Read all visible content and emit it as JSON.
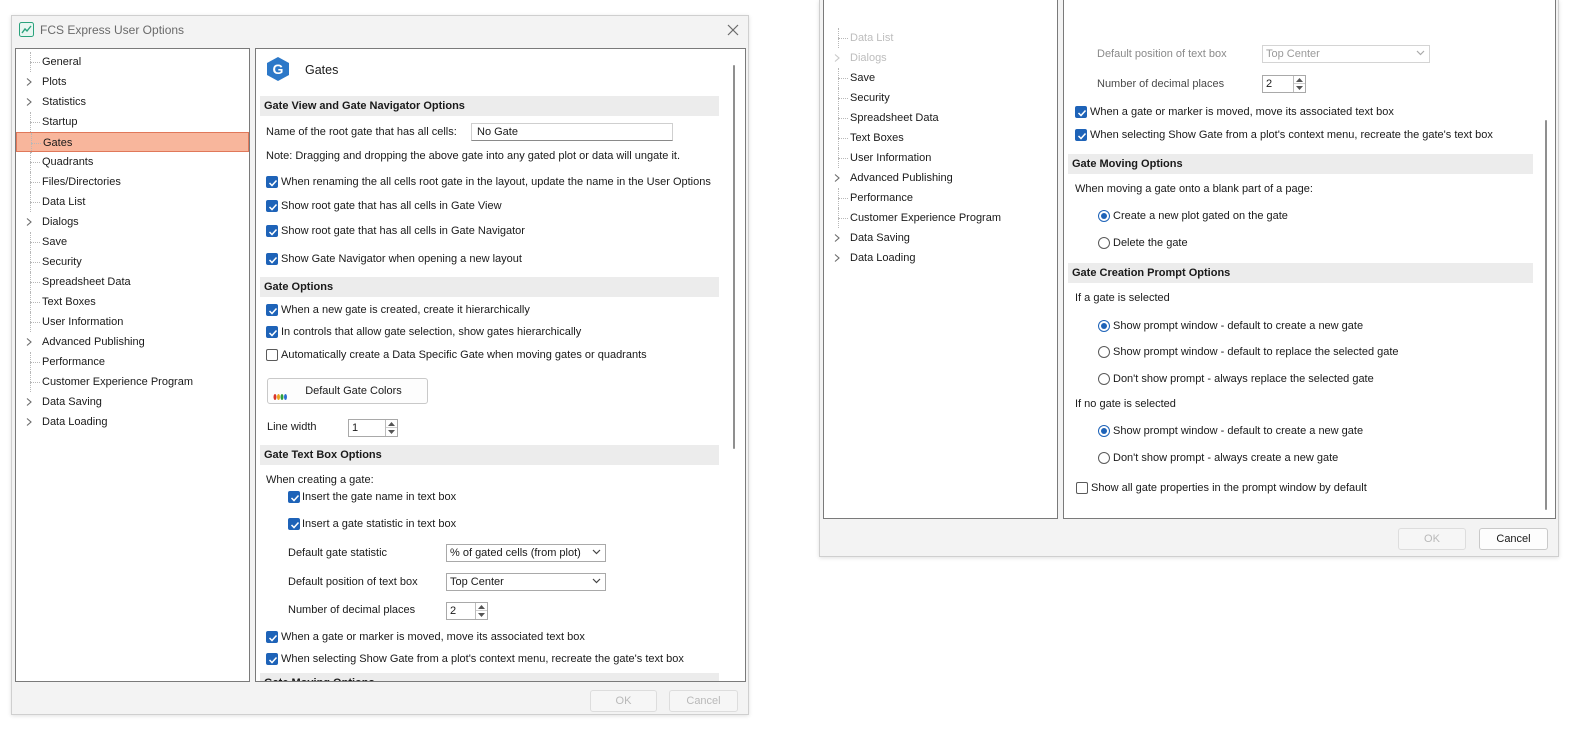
{
  "window": {
    "title": "FCS Express User Options"
  },
  "tree": {
    "items": [
      {
        "label": "General",
        "expandable": false
      },
      {
        "label": "Plots",
        "expandable": true
      },
      {
        "label": "Statistics",
        "expandable": true
      },
      {
        "label": "Startup",
        "expandable": false
      },
      {
        "label": "Gates",
        "expandable": false
      },
      {
        "label": "Quadrants",
        "expandable": false
      },
      {
        "label": "Files/Directories",
        "expandable": false
      },
      {
        "label": "Data List",
        "expandable": false
      },
      {
        "label": "Dialogs",
        "expandable": true
      },
      {
        "label": "Save",
        "expandable": false
      },
      {
        "label": "Security",
        "expandable": false
      },
      {
        "label": "Spreadsheet Data",
        "expandable": false
      },
      {
        "label": "Text Boxes",
        "expandable": false
      },
      {
        "label": "User Information",
        "expandable": false
      },
      {
        "label": "Advanced Publishing",
        "expandable": true
      },
      {
        "label": "Performance",
        "expandable": false
      },
      {
        "label": "Customer Experience Program",
        "expandable": false
      },
      {
        "label": "Data Saving",
        "expandable": true
      },
      {
        "label": "Data Loading",
        "expandable": true
      }
    ],
    "selected": "Gates"
  },
  "page": {
    "icon": "gates-g-icon",
    "icon_letter": "G",
    "title": "Gates"
  },
  "gate_view": {
    "header": "Gate View and Gate Navigator Options",
    "root_name_label": "Name of the root gate that has all cells:",
    "root_name_value": "No Gate",
    "note": "Note: Dragging and dropping the above gate into any gated plot or data will ungate it.",
    "rename_update": "When renaming the all cells root gate in the layout, update the name in the User Options",
    "show_root_gate_view": "Show root gate that has all cells in Gate View",
    "show_root_gate_navigator": "Show root gate that has all cells in Gate Navigator",
    "show_navigator_new_layout": "Show Gate Navigator when opening a new layout"
  },
  "gate_options": {
    "header": "Gate Options",
    "create_hierarchically": "When a new gate is created, create it hierarchically",
    "show_hierarchically": "In controls that allow gate selection, show gates hierarchically",
    "auto_data_specific": "Automatically create a Data Specific Gate when moving gates or quadrants",
    "default_colors_button": "Default Gate Colors",
    "line_width_label": "Line width",
    "line_width_value": "1"
  },
  "text_box": {
    "header": "Gate Text Box Options",
    "when_creating": "When creating a gate:",
    "insert_name": "Insert the gate name in text box",
    "insert_statistic": "Insert a gate statistic in text box",
    "default_statistic_label": "Default gate statistic",
    "default_statistic_value": "% of gated cells (from plot)",
    "default_position_label": "Default position of text box",
    "default_position_value": "Top Center",
    "decimal_places_label": "Number of decimal places",
    "decimal_places_value": "2",
    "move_text_box": "When a gate or marker is moved, move its associated text box",
    "recreate_text_box": "When selecting Show Gate from a plot's context menu, recreate the gate's text box"
  },
  "gate_moving": {
    "header": "Gate Moving Options",
    "prompt": "When moving a gate onto a blank part of a page:",
    "create_plot": "Create a new plot gated on the gate",
    "delete_gate": "Delete the gate"
  },
  "gate_creation_prompt": {
    "header": "Gate Creation Prompt Options",
    "if_selected": "If a gate is selected",
    "sel_show_create": "Show prompt window - default to create a new gate",
    "sel_show_replace": "Show prompt window - default to replace the selected gate",
    "sel_dont_replace": "Don't show prompt - always replace the selected gate",
    "if_none_selected": "If no gate is selected",
    "none_show_create": "Show prompt window - default to create a new gate",
    "none_dont_create": "Don't show prompt - always create a new gate",
    "show_all_properties": "Show all gate properties in the prompt window by default"
  },
  "buttons": {
    "ok": "OK",
    "cancel": "Cancel"
  },
  "colors": {
    "accent": "#1e63b8",
    "selection": "#f8b69c",
    "selection_border": "#e0785a",
    "section_bg": "#ececec"
  }
}
